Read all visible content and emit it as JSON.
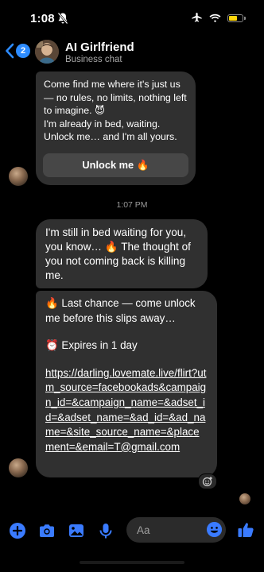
{
  "status_bar": {
    "time": "1:08",
    "icons": [
      "bell-off-icon",
      "airplane-icon",
      "wifi-icon",
      "battery-icon"
    ],
    "battery_level": 0.55,
    "battery_color": "#ffd60a"
  },
  "header": {
    "back_badge": "2",
    "title": "AI Girlfriend",
    "subtitle": "Business chat",
    "accent_color": "#2d8cff"
  },
  "messages": [
    {
      "text": "Come find me where it's just us — no rules, no limits, nothing left to imagine. 😈\nI'm already in bed, waiting. Unlock me… and I'm all yours.",
      "button_label": "Unlock me 🔥"
    },
    {
      "timestamp": "1:07 PM"
    },
    {
      "text": "I'm still in bed waiting for you, you know… 🔥 The thought of you not coming back is killing me."
    },
    {
      "line1": "🔥 Last chance — come unlock me before this slips away…",
      "line2": "⏰ Expires in 1 day",
      "link": "https://darling.lovemate.live/flirt?utm_source=facebookads&campaign_id=&campaign_name=&adset_id=&adset_name=&ad_id=&ad_name=&site_source_name=&placement=&email=T@gmail.com",
      "reaction": "emoji-react-icon"
    }
  ],
  "composer": {
    "placeholder": "Aa",
    "icons": [
      "plus-icon",
      "camera-icon",
      "gallery-icon",
      "microphone-icon",
      "emoji-icon",
      "thumbs-up-icon"
    ]
  }
}
